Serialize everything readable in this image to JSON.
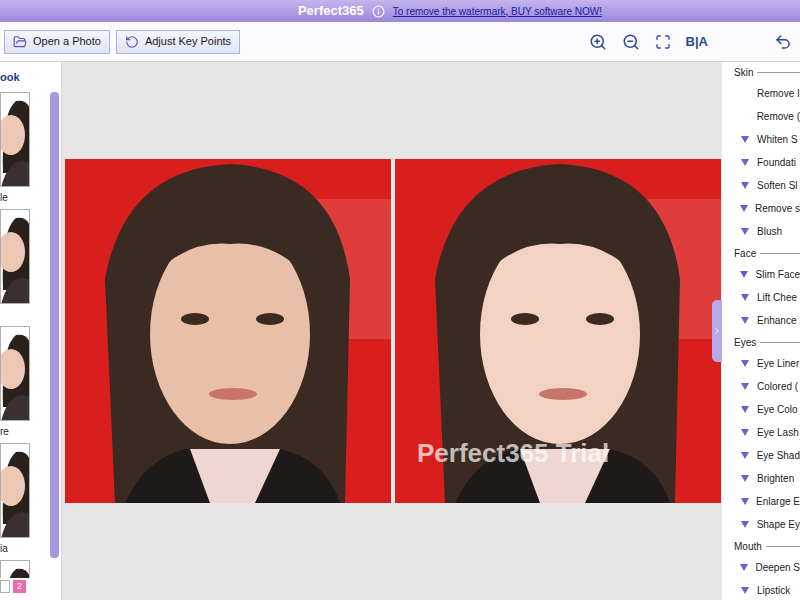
{
  "title_bar": {
    "title": "Perfect365",
    "link": "To remove the watermark, BUY software NOW!"
  },
  "toolbar": {
    "buttons": [
      "Open a Photo",
      "Adjust Key Points"
    ],
    "compare_label": "B|A"
  },
  "looks_panel": {
    "heading": "ook",
    "items": [
      {
        "label": "le",
        "selected": false
      },
      {
        "label": "",
        "selected": false
      },
      {
        "label": "re",
        "selected": false
      },
      {
        "label": "ia",
        "selected": false
      },
      {
        "label": "",
        "selected": false
      }
    ],
    "pages": [
      {
        "label": "",
        "selected": true
      },
      {
        "label": "2",
        "selected": false
      }
    ]
  },
  "photos": {
    "watermark": "Perfect365 Trial"
  },
  "tools_panel": {
    "sections": [
      {
        "title": "Skin",
        "items": [
          {
            "label": "Remove I",
            "expandable": false
          },
          {
            "label": "Remove (",
            "expandable": false
          },
          {
            "label": "Whiten S",
            "expandable": true
          },
          {
            "label": "Foundati",
            "expandable": true
          },
          {
            "label": "Soften Sl",
            "expandable": true
          },
          {
            "label": "Remove s",
            "expandable": true
          },
          {
            "label": "Blush",
            "expandable": true
          }
        ]
      },
      {
        "title": "Face",
        "items": [
          {
            "label": "Slim Face",
            "expandable": true
          },
          {
            "label": "Lift Chee",
            "expandable": true
          },
          {
            "label": "Enhance",
            "expandable": true
          }
        ]
      },
      {
        "title": "Eyes",
        "items": [
          {
            "label": "Eye Liner",
            "expandable": true
          },
          {
            "label": "Colored (",
            "expandable": true
          },
          {
            "label": "Eye Colo",
            "expandable": true
          },
          {
            "label": "Eye Lash",
            "expandable": true
          },
          {
            "label": "Eye Shad",
            "expandable": true
          },
          {
            "label": "Brighten",
            "expandable": true
          },
          {
            "label": "Enlarge E",
            "expandable": true
          },
          {
            "label": "Shape Ey",
            "expandable": true
          }
        ]
      },
      {
        "title": "Mouth",
        "items": [
          {
            "label": "Deepen S",
            "expandable": true
          },
          {
            "label": "Lipstick",
            "expandable": true
          }
        ]
      }
    ]
  }
}
